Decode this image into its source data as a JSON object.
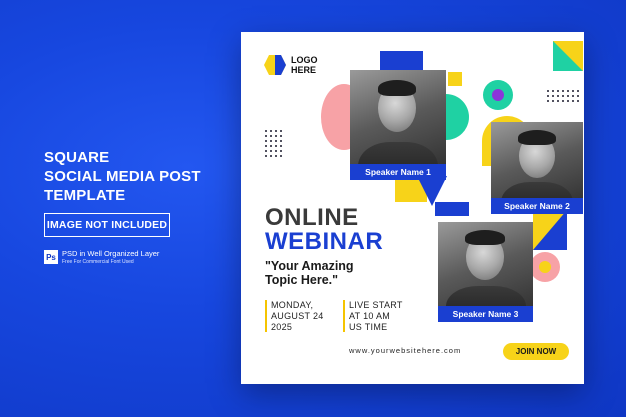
{
  "promo": {
    "title_lines": [
      "SQUARE",
      "SOCIAL MEDIA POST",
      "TEMPLATE"
    ],
    "badge": "IMAGE NOT INCLUDED",
    "ps_label": "Ps",
    "psd_line": "PSD in Well Organized Layer",
    "font_line": "Free For Commercial Font Used"
  },
  "card": {
    "logo_line1": "LOGO",
    "logo_line2": "HERE",
    "heading_line1": "ONLINE",
    "heading_line2": "WEBINAR",
    "topic_line1": "\"Your Amazing",
    "topic_line2": "Topic Here.\"",
    "date_lines": [
      "MONDAY,",
      "AUGUST 24",
      "2025"
    ],
    "time_lines": [
      "LIVE START",
      "AT 10 AM",
      "US TIME"
    ],
    "website": "www.yourwebsitehere.com",
    "cta": "JOIN NOW",
    "speakers": [
      "Speaker Name 1",
      "Speaker Name 2",
      "Speaker Name 3"
    ]
  },
  "colors": {
    "background": "#1747df",
    "brand_blue": "#1a3fd1",
    "yellow": "#f7d319",
    "teal": "#1fd1a3",
    "pink": "#f7a2a6",
    "purple": "#8c35d9"
  }
}
